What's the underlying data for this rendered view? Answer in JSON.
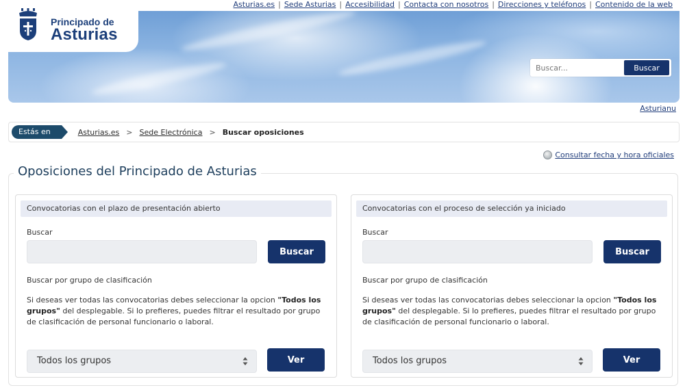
{
  "top_links": [
    "Asturias.es",
    "Sede Asturias",
    "Accesibilidad",
    "Contacta con nosotros",
    "Direcciones y teléfonos",
    "Contenido de la web"
  ],
  "logo": {
    "line1": "Principado de",
    "line2": "Asturias"
  },
  "header_search": {
    "placeholder": "Buscar...",
    "button": "Buscar"
  },
  "language_link": "Asturianu",
  "breadcrumb": {
    "label": "Estás en",
    "items": [
      "Asturias.es",
      "Sede Electrónica"
    ],
    "separator": ">",
    "current": "Buscar oposiciones"
  },
  "official_time_link": "Consultar fecha y hora oficiales",
  "page_title": "Oposiciones del Principado de Asturias",
  "panels": [
    {
      "heading": "Convocatorias con el plazo de presentación abierto",
      "search_label": "Buscar",
      "search_button": "Buscar",
      "group_label": "Buscar por grupo de clasificación",
      "desc_pre": "Si deseas ver todas las convocatorias debes seleccionar la opcion ",
      "desc_bold": "\"Todos los grupos\"",
      "desc_post": " del desplegable. Si lo prefieres, puedes filtrar el resultado por grupo de clasificación de personal funcionario o laboral.",
      "select_value": "Todos los grupos",
      "view_button": "Ver"
    },
    {
      "heading": "Convocatorias con el proceso de selección ya iniciado",
      "search_label": "Buscar",
      "search_button": "Buscar",
      "group_label": "Buscar por grupo de clasificación",
      "desc_pre": "Si deseas ver todas las convocatorias debes seleccionar la opcion ",
      "desc_bold": "\"Todos los grupos\"",
      "desc_post": " del desplegable. Si lo prefieres, puedes filtrar el resultado por grupo de clasificación de personal funcionario o laboral.",
      "select_value": "Todos los grupos",
      "view_button": "Ver"
    }
  ],
  "colors": {
    "primary": "#16336b",
    "breadcrumb_label": "#1d4b6b",
    "panel_head": "#e8ebf4"
  }
}
